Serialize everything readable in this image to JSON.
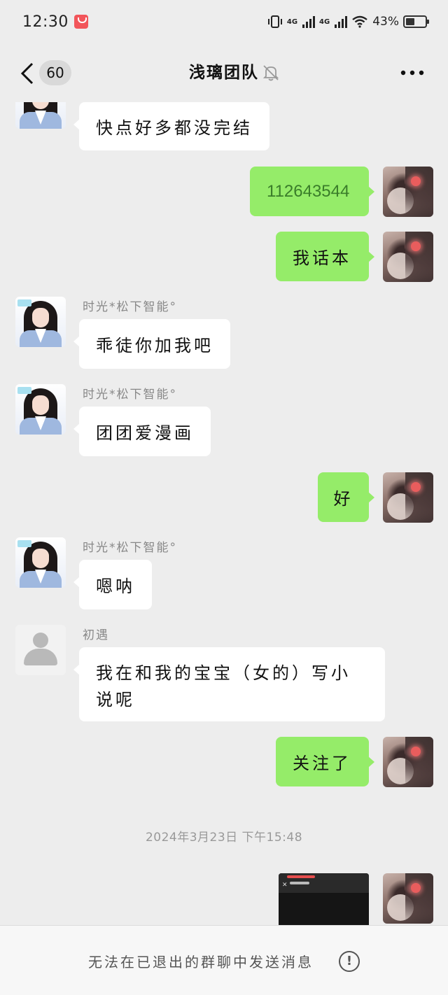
{
  "status_bar": {
    "time": "12:30",
    "network_1": "4G",
    "network_2": "4G",
    "battery": "43%"
  },
  "nav": {
    "unread_count": "60",
    "title": "浅璃团队"
  },
  "messages": [
    {
      "id": "m1",
      "side": "left",
      "sender": "",
      "text": "快点好多都没完结"
    },
    {
      "id": "m2",
      "side": "right",
      "text": "112643544"
    },
    {
      "id": "m3",
      "side": "right",
      "text": "我话本"
    },
    {
      "id": "m4",
      "side": "left",
      "sender": "时光*松下智能°",
      "text": "乖徒你加我吧"
    },
    {
      "id": "m5",
      "side": "left",
      "sender": "时光*松下智能°",
      "text": "团团爱漫画"
    },
    {
      "id": "m6",
      "side": "right",
      "text": "好"
    },
    {
      "id": "m7",
      "side": "left",
      "sender": "时光*松下智能°",
      "text": "嗯呐"
    },
    {
      "id": "m8",
      "side": "left",
      "sender": "初遇",
      "text": "我在和我的宝宝（女的）写小说呢"
    },
    {
      "id": "m9",
      "side": "right",
      "text": "关注了"
    },
    {
      "id": "m10",
      "side": "right",
      "type": "image"
    }
  ],
  "timestamp": "2024年3月23日 下午15:48",
  "bottom_bar": {
    "notice": "无法在已退出的群聊中发送消息",
    "info_glyph": "!"
  },
  "colors": {
    "background": "#ededed",
    "my_bubble": "#95ec69",
    "other_bubble": "#ffffff"
  }
}
